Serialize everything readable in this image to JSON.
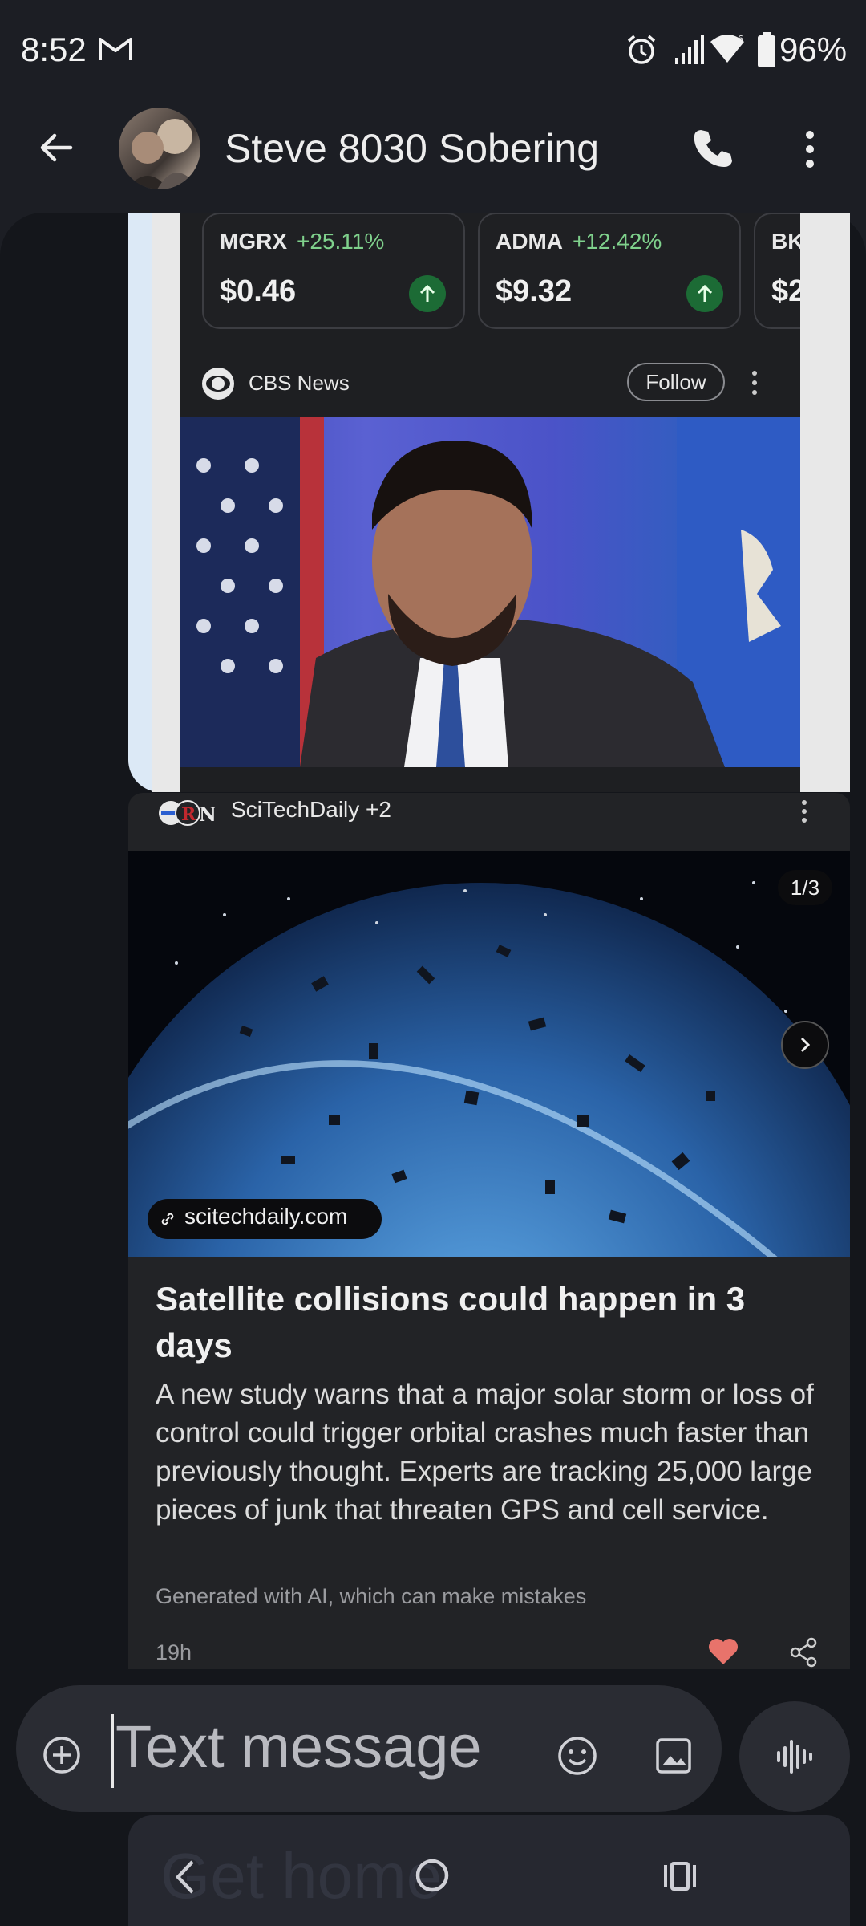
{
  "status_bar": {
    "time": "8:52",
    "battery": "96%",
    "icons": [
      "gmail-icon",
      "alarm-icon",
      "signal-icon",
      "wifi-icon",
      "battery-icon"
    ]
  },
  "app_bar": {
    "contact_name": "Steve 8030 Sobering",
    "icons": [
      "back-arrow-icon",
      "phone-icon",
      "more-vert-icon"
    ]
  },
  "screenshot_message": {
    "stocks": [
      {
        "symbol": "MGRX",
        "change": "+25.11%",
        "price": "$0.46"
      },
      {
        "symbol": "ADMA",
        "change": "+12.42%",
        "price": "$9.32"
      },
      {
        "symbol": "BK",
        "change": "",
        "price": "$2"
      }
    ],
    "source": "CBS News",
    "follow_label": "Follow"
  },
  "news_card": {
    "source": "SciTechDaily +2",
    "counter": "1/3",
    "link": "scitechdaily.com",
    "headline": "Satellite collisions could happen in 3 days",
    "summary": "A new study warns that a major solar storm or loss of control could trigger orbital crashes much faster than previously thought. Experts are tracking 25,000 large pieces of junk that threaten GPS and cell service.",
    "ai_note": "Generated with AI, which can make mistakes",
    "time_ago": "19h"
  },
  "compose": {
    "placeholder": "Text message"
  },
  "ghost_message": "Get home",
  "colors": {
    "background": "#1c1e24",
    "panel": "#14161b",
    "bubble": "#dce9f6",
    "card": "#222326",
    "up_green": "#7fd18c",
    "heart": "#e8736b"
  }
}
